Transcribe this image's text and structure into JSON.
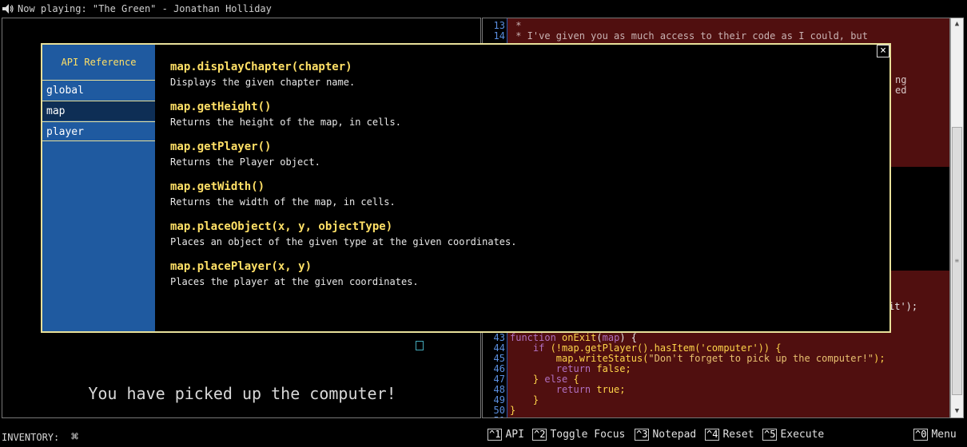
{
  "topbar": {
    "now_playing": "Now playing: \"The Green\" - Jonathan Holliday"
  },
  "game": {
    "status_message": "You have picked up the computer!"
  },
  "editor": {
    "lines": [
      {
        "n": "13",
        "parts": [
          [
            "cm",
            " *"
          ]
        ]
      },
      {
        "n": "14",
        "parts": [
          [
            "cm",
            " * I've given you as much access to their code as I could, but"
          ]
        ]
      },
      {
        "n": "43",
        "parts": [
          [
            "kw",
            "function "
          ],
          [
            "grn",
            "onExit"
          ],
          [
            "",
            "("
          ],
          [
            "kw",
            "map"
          ],
          [
            "",
            ") {"
          ]
        ]
      },
      {
        "n": "44",
        "parts": [
          [
            "",
            "    "
          ],
          [
            "kw",
            "if"
          ],
          [
            "grn",
            " (!map.getPlayer().hasItem('computer')) {"
          ]
        ]
      },
      {
        "n": "45",
        "parts": [
          [
            "",
            "        "
          ],
          [
            "grn",
            "map.writeStatus("
          ],
          [
            "str",
            "\"Don't forget to pick up the computer!\""
          ],
          [
            "grn",
            ");"
          ]
        ]
      },
      {
        "n": "46",
        "parts": [
          [
            "",
            "        "
          ],
          [
            "kw",
            "return "
          ],
          [
            "grn",
            "false;"
          ]
        ]
      },
      {
        "n": "47",
        "parts": [
          [
            "",
            "    "
          ],
          [
            "grn",
            "} "
          ],
          [
            "kw",
            "else"
          ],
          [
            "grn",
            " {"
          ]
        ]
      },
      {
        "n": "48",
        "parts": [
          [
            "",
            "        "
          ],
          [
            "kw",
            "return "
          ],
          [
            "grn",
            "true;"
          ]
        ]
      },
      {
        "n": "49",
        "parts": [
          [
            "grn",
            "    }"
          ]
        ]
      },
      {
        "n": "50",
        "parts": [
          [
            "grn",
            "}"
          ]
        ]
      },
      {
        "n": "51",
        "parts": [
          [
            "",
            ""
          ]
        ]
      }
    ],
    "fragments": [
      "ng",
      "ed",
      "it');"
    ]
  },
  "bottombar": {
    "inventory_label": "INVENTORY:",
    "inventory_icon": "⌘",
    "hotkeys": [
      {
        "key": "^1",
        "label": "API"
      },
      {
        "key": "^2",
        "label": "Toggle Focus"
      },
      {
        "key": "^3",
        "label": "Notepad"
      },
      {
        "key": "^4",
        "label": "Reset"
      },
      {
        "key": "^5",
        "label": "Execute"
      },
      {
        "key": "^0",
        "label": "Menu"
      }
    ]
  },
  "api_modal": {
    "title": "API Reference",
    "close_label": "×",
    "categories": [
      "global",
      "map",
      "player"
    ],
    "selected_category": "map",
    "entries": [
      {
        "signature": "map.displayChapter(chapter)",
        "description": "Displays the given chapter name."
      },
      {
        "signature": "map.getHeight()",
        "description": "Returns the height of the map, in cells."
      },
      {
        "signature": "map.getPlayer()",
        "description": "Returns the Player object."
      },
      {
        "signature": "map.getWidth()",
        "description": "Returns the width of the map, in cells."
      },
      {
        "signature": "map.placeObject(x, y, objectType)",
        "description": "Places an object of the given type at the given coordinates."
      },
      {
        "signature": "map.placePlayer(x, y)",
        "description": "Places the player at the given coordinates."
      }
    ]
  },
  "colors": {
    "modal_border": "#e8e09a",
    "sidebar": "#1f5aa0",
    "code_bg": "#500f0f",
    "api_signature": "#ffe066"
  }
}
